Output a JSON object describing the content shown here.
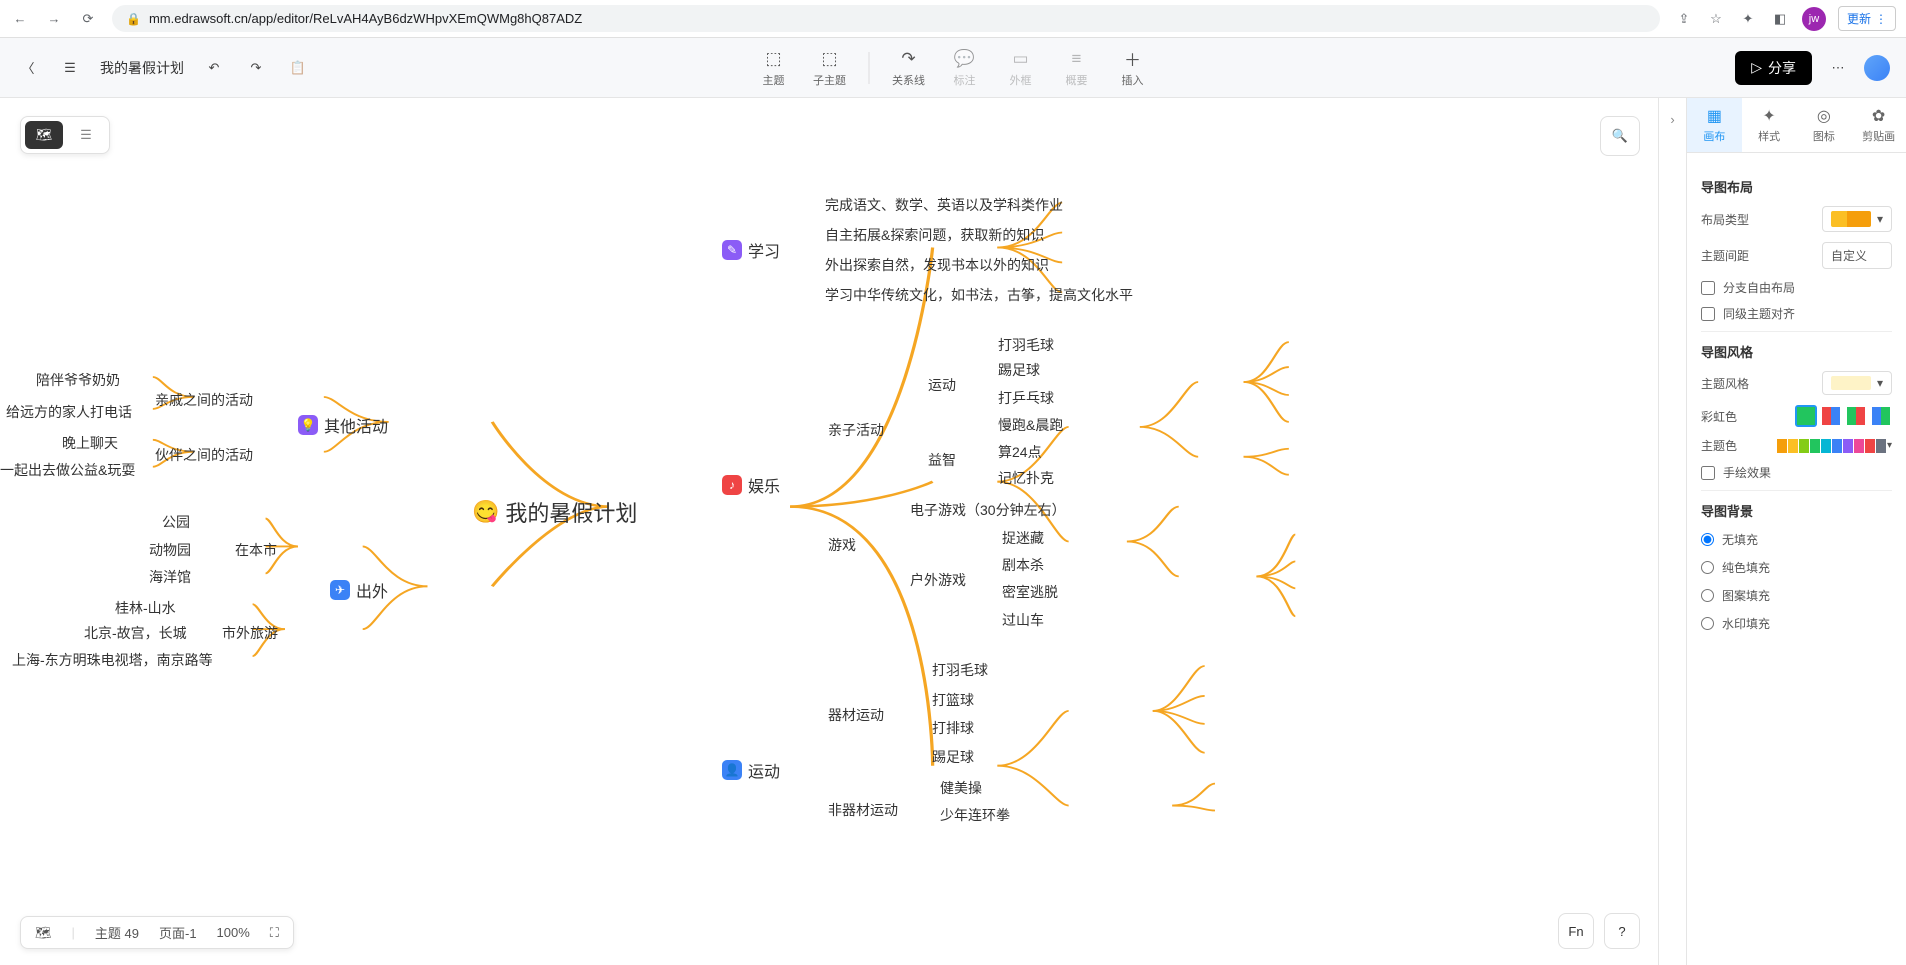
{
  "browser": {
    "url": "mm.edrawsoft.cn/app/editor/ReLvAH4AyB6dzWHpvXEmQWMg8hQ87ADZ",
    "avatar": "jw",
    "update": "更新"
  },
  "app": {
    "title": "我的暑假计划"
  },
  "toolbar": {
    "topic": "主题",
    "subtopic": "子主题",
    "relation": "关系线",
    "note": "标注",
    "frame": "外框",
    "summary": "概要",
    "insert": "插入"
  },
  "share": "分享",
  "status": {
    "topic_count": "主题 49",
    "page": "页面-1",
    "zoom": "100%"
  },
  "side_tabs": {
    "canvas": "画布",
    "style": "样式",
    "icon": "图标",
    "clipart": "剪贴画"
  },
  "panel": {
    "layout_title": "导图布局",
    "layout_type": "布局类型",
    "topic_spacing": "主题间距",
    "spacing_value": "自定义",
    "free_layout": "分支自由布局",
    "align_siblings": "同级主题对齐",
    "style_title": "导图风格",
    "theme_style": "主题风格",
    "rainbow": "彩虹色",
    "theme_color": "主题色",
    "hand_drawn": "手绘效果",
    "bg_title": "导图背景",
    "bg_none": "无填充",
    "bg_solid": "纯色填充",
    "bg_pattern": "图案填充",
    "bg_watermark": "水印填充"
  },
  "mindmap": {
    "root": "我的暑假计划",
    "right": [
      {
        "label": "学习",
        "color": "#8b5cf6",
        "children": [
          "完成语文、数学、英语以及学科类作业",
          "自主拓展&探索问题，获取新的知识",
          "外出探索自然，发现书本以外的知识",
          "学习中华传统文化，如书法，古筝，提高文化水平"
        ]
      },
      {
        "label": "娱乐",
        "color": "#ef4444",
        "children": [
          {
            "label": "亲子活动",
            "children": [
              {
                "label": "运动",
                "children": [
                  "打羽毛球",
                  "踢足球",
                  "打乒乓球",
                  "慢跑&晨跑"
                ]
              },
              {
                "label": "益智",
                "children": [
                  "算24点",
                  "记忆扑克"
                ]
              }
            ]
          },
          {
            "label": "游戏",
            "children": [
              "电子游戏（30分钟左右）",
              {
                "label": "户外游戏",
                "children": [
                  "捉迷藏",
                  "剧本杀",
                  "密室逃脱",
                  "过山车"
                ]
              }
            ]
          }
        ]
      },
      {
        "label": "运动",
        "color": "#3b82f6",
        "children": [
          {
            "label": "器材运动",
            "children": [
              "打羽毛球",
              "打篮球",
              "打排球",
              "踢足球"
            ]
          },
          {
            "label": "非器材运动",
            "children": [
              "健美操",
              "少年连环拳"
            ]
          }
        ]
      }
    ],
    "left": [
      {
        "label": "其他活动",
        "color": "#8b5cf6",
        "children": [
          {
            "label": "亲戚之间的活动",
            "children": [
              "陪伴爷爷奶奶",
              "给远方的家人打电话"
            ]
          },
          {
            "label": "伙伴之间的活动",
            "children": [
              "晚上聊天",
              "一起出去做公益&玩耍"
            ]
          }
        ]
      },
      {
        "label": "出外",
        "color": "#3b82f6",
        "children": [
          {
            "label": "在本市",
            "children": [
              "公园",
              "动物园",
              "海洋馆"
            ]
          },
          {
            "label": "市外旅游",
            "children": [
              "桂林-山水",
              "北京-故宫，长城",
              "上海-东方明珠电视塔，南京路等"
            ]
          }
        ]
      }
    ]
  },
  "theme_colors": [
    "#f59e0b",
    "#fbbf24",
    "#84cc16",
    "#22c55e",
    "#06b6d4",
    "#3b82f6",
    "#8b5cf6",
    "#ec4899",
    "#ef4444",
    "#6b7280"
  ]
}
